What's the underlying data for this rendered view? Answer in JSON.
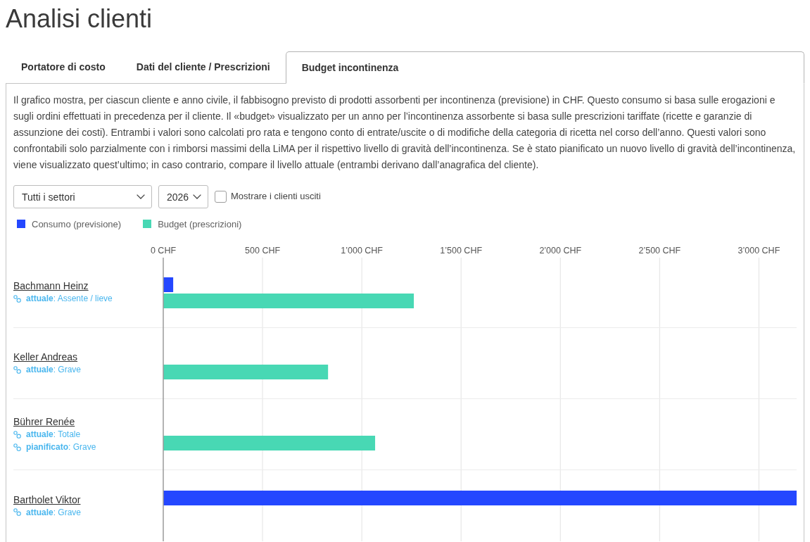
{
  "page_title": "Analisi clienti",
  "tabs": [
    {
      "label": "Portatore di costo",
      "selected": false
    },
    {
      "label": "Dati del cliente / Prescrizioni",
      "selected": false
    },
    {
      "label": "Budget incontinenza",
      "selected": true
    }
  ],
  "description": "Il grafico mostra, per ciascun cliente e anno civile, il fabbisogno previsto di prodotti assorbenti per incontinenza (previsione) in CHF. Questo consumo si basa sulle erogazioni e sugli ordini effettuati in precedenza per il cliente. Il «budget» visualizzato per un anno per l’incontinenza assorbente si basa sulle prescrizioni tariffate (ricette e garanzie di assunzione dei costi). Entrambi i valori sono calcolati pro rata e tengono conto di entrate/uscite o di modifiche della categoria di ricetta nel corso dell’anno. Questi valori sono confrontabili solo parzialmente con i rimborsi massimi della LiMA per il rispettivo livello di gravità dell’incontinenza. Se è stato pianificato un nuovo livello di gravità dell’incontinenza, viene visualizzato quest’ultimo; in caso contrario, compare il livello attuale (entrambi derivano dall’anagrafica del cliente).",
  "filters": {
    "sector": {
      "value": "Tutti i settori"
    },
    "year": {
      "value": "2026"
    },
    "show_exited": {
      "label": "Mostrare i clienti usciti",
      "checked": false
    }
  },
  "chart": {
    "chart_data": {
      "type": "bar",
      "orientation": "horizontal",
      "categories": [
        "Bachmann Heinz",
        "Keller Andreas",
        "Bührer Renée",
        "Bartholet Viktor"
      ],
      "series": [
        {
          "name": "Consumo (previsione)",
          "color": "#2447ff",
          "values": [
            50,
            0,
            0,
            3190
          ]
        },
        {
          "name": "Budget (prescrizioni)",
          "color": "#48d8b4",
          "values": [
            1262,
            830,
            1067,
            0
          ]
        }
      ],
      "xlim": [
        0,
        3190
      ],
      "xticks": [
        {
          "value": 0,
          "label": "0 CHF"
        },
        {
          "value": 500,
          "label": "500 CHF"
        },
        {
          "value": 1000,
          "label": "1’000 CHF"
        },
        {
          "value": 1500,
          "label": "1’500 CHF"
        },
        {
          "value": 2000,
          "label": "2’000 CHF"
        },
        {
          "value": 2500,
          "label": "2’500 CHF"
        },
        {
          "value": 3000,
          "label": "3’000 CHF"
        }
      ],
      "grid": true,
      "legend": "top"
    },
    "client_levels": [
      [
        "**attuale**: Assente / lieve"
      ],
      [
        "**attuale**: Grave"
      ],
      [
        "**attuale**: Totale",
        "**pianificato**: Grave"
      ],
      [
        "**attuale**: Grave"
      ]
    ]
  }
}
